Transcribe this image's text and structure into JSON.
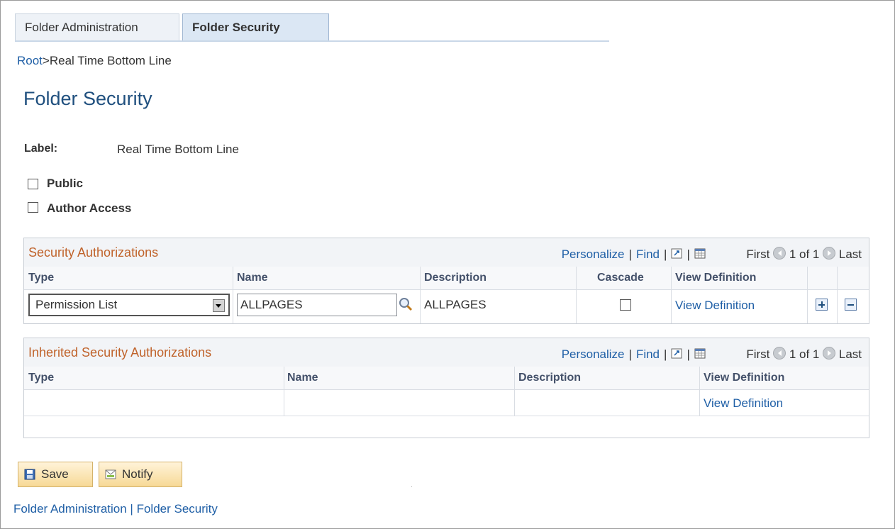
{
  "tabs": [
    {
      "label": "Folder Administration"
    },
    {
      "label": "Folder Security"
    }
  ],
  "breadcrumb": {
    "root": "Root",
    "current": ">Real Time Bottom Line"
  },
  "page_title": "Folder Security",
  "label_field": {
    "caption": "Label:",
    "value": "Real Time Bottom Line"
  },
  "checkboxes": {
    "public": {
      "label": "Public",
      "checked": false
    },
    "author_access": {
      "label": "Author Access",
      "checked": false
    }
  },
  "grid_nav": {
    "personalize": "Personalize",
    "find": "Find",
    "first": "First",
    "range": "1 of 1",
    "last": "Last",
    "sep": "|"
  },
  "security_grid": {
    "title": "Security Authorizations",
    "columns": [
      "Type",
      "Name",
      "Description",
      "Cascade",
      "View Definition"
    ],
    "rows": [
      {
        "type": "Permission List",
        "name": "ALLPAGES",
        "description": "ALLPAGES",
        "cascade": false,
        "view_definition": "View Definition"
      }
    ]
  },
  "inherited_grid": {
    "title": "Inherited Security Authorizations",
    "columns": [
      "Type",
      "Name",
      "Description",
      "View Definition"
    ],
    "rows": [
      {
        "type": "",
        "name": "",
        "description": "",
        "view_definition": "View Definition"
      }
    ]
  },
  "buttons": {
    "save": "Save",
    "notify": "Notify"
  },
  "footer_links": {
    "folder_admin": "Folder Administration",
    "sep": "|",
    "folder_security": "Folder Security"
  },
  "colors": {
    "link": "#1f5fa6",
    "grid_title": "#c0632b",
    "page_title": "#1f4f7e"
  }
}
